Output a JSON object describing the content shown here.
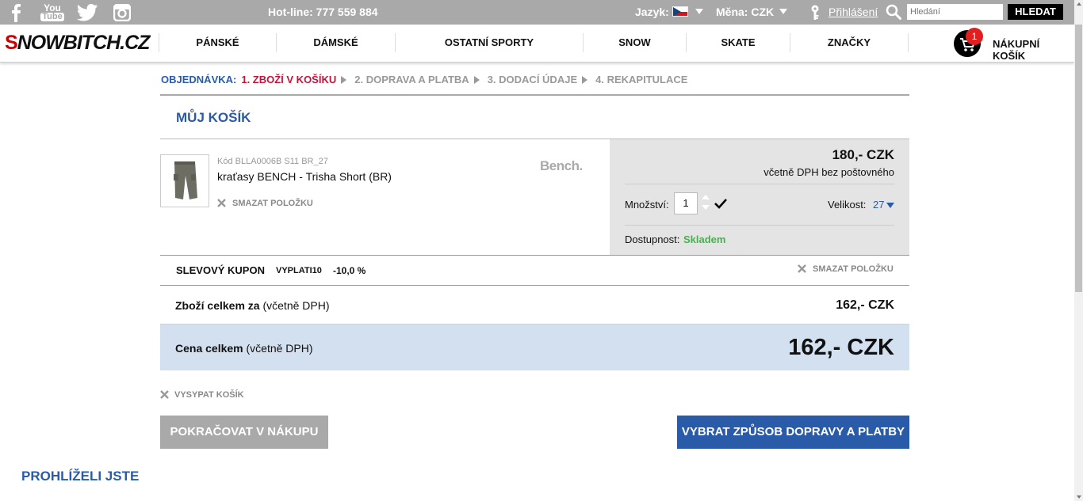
{
  "topbar": {
    "social": [
      "facebook-icon",
      "youtube-icon",
      "twitter-icon",
      "instagram-icon"
    ],
    "youtube_text_1": "You",
    "youtube_text_2": "Tube",
    "hotline": "Hot-line: 777 559 884",
    "language_label": "Jazyk:",
    "currency_label": "Měna: CZK",
    "login_label": "Přihlášení",
    "search_placeholder": "Hledání",
    "search_button": "HLEDAT"
  },
  "nav": {
    "logo_mark": "S",
    "logo_text": "NOWBITCH.CZ",
    "items": [
      "PÁNSKÉ",
      "DÁMSKÉ",
      "OSTATNÍ SPORTY",
      "SNOW",
      "SKATE",
      "ZNAČKY"
    ],
    "cart_count": "1",
    "cart_label": "NÁKUPNÍ KOŠÍK"
  },
  "steps": {
    "label": "OBJEDNÁVKA:",
    "items": [
      "1. ZBOŽÍ V KOŠÍKU",
      "2. DOPRAVA A PLATBA",
      "3. DODACÍ ÚDAJE",
      "4. REKAPITULACE"
    ]
  },
  "cart": {
    "title": "MŮJ KOŠÍK",
    "product": {
      "code": "Kód BLLA0006B S11 BR_27",
      "name": "kraťasy BENCH - Trisha Short (BR)",
      "remove_label": "SMAZAT POLOŽKU",
      "brand": "Bench.",
      "price": "180,-   CZK",
      "price_note": "včetně DPH bez poštovného",
      "quantity_label": "Množství:",
      "quantity": "1",
      "size_label": "Velikost:",
      "size": "27",
      "availability_label": "Dostupnost:",
      "availability": "Skladem"
    },
    "coupon": {
      "label": "SLEVOVÝ KUPON",
      "code": "VYPLATI10",
      "discount": "-10,0 %",
      "remove_label": "SMAZAT POLOŽKU"
    },
    "subtotal": {
      "label_bold": "Zboží celkem za",
      "label_note": " (včetně DPH)",
      "value": "162,- CZK"
    },
    "total": {
      "label_bold": "Cena celkem",
      "label_note": " (včetně DPH)",
      "value": "162,- CZK"
    },
    "empty_label": "VYSYPAT KOŠÍK",
    "continue_button": "POKRAČOVAT V NÁKUPU",
    "next_button": "VYBRAT ZPŮSOB DOPRAVY A PLATBY"
  },
  "recently_viewed_title": "PROHLÍŽELI JSTE",
  "colors": {
    "topbar": "#a9a9a9",
    "accent_blue": "#2a5ba8",
    "active_step": "#c0143c",
    "inactive_step": "#999999",
    "stock_green": "#4caf50",
    "total_bg": "#d3e0ef"
  }
}
